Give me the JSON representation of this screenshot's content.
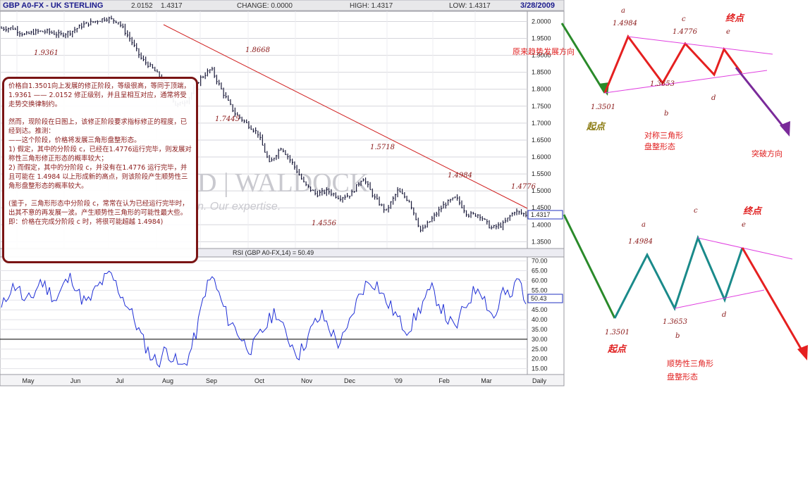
{
  "header": {
    "title": "GBP A0-FX - UK STERLING",
    "max_price": "2.0152",
    "last": "1.4317",
    "change": "CHANGE: 0.0000",
    "high": "HIGH: 1.4317",
    "low": "LOW: 1.4317",
    "date": "3/28/2009"
  },
  "watermark": {
    "text": "D | WALDOCK",
    "tagline": "n. Our expertise."
  },
  "rsi_label": "RSI (GBP A0-FX,14) = 50.49",
  "colors": {
    "price": "#1a1a3a",
    "rsi": "#1f2fd6",
    "trendline": "#d02020",
    "annotation": "#8b1a1a",
    "up_leg": "#2a8a2a",
    "triangle": "#e040e0"
  },
  "chart_data": [
    {
      "type": "bar",
      "title": "GBP A0-FX - UK STERLING",
      "x": [
        "Apr-25",
        "May-05",
        "May-15",
        "May-25",
        "Jun-05",
        "Jun-15",
        "Jun-25",
        "Jul-05",
        "Jul-15",
        "Jul-25",
        "Aug-01",
        "Aug-08",
        "Aug-15",
        "Aug-22",
        "Aug-29",
        "Sep-05",
        "Sep-10",
        "Sep-15",
        "Sep-22",
        "Sep-29",
        "Oct-06",
        "Oct-13",
        "Oct-20",
        "Oct-24",
        "Oct-31",
        "Nov-07",
        "Nov-14",
        "Nov-21",
        "Nov-28",
        "Dec-05",
        "Dec-12",
        "Dec-19",
        "Dec-29",
        "Jan-05",
        "Jan-12",
        "Jan-19",
        "Jan-23",
        "Jan-30",
        "Feb-06",
        "Feb-13",
        "Feb-20",
        "Feb-27",
        "Mar-06",
        "Mar-13",
        "Mar-20",
        "Mar-27"
      ],
      "values": [
        1.98,
        1.98,
        1.96,
        1.97,
        1.97,
        1.96,
        1.97,
        1.99,
        2.0,
        2.01,
        2.0,
        1.95,
        1.89,
        1.86,
        1.82,
        1.75,
        1.77,
        1.83,
        1.86,
        1.79,
        1.73,
        1.7,
        1.67,
        1.58,
        1.63,
        1.58,
        1.52,
        1.49,
        1.5,
        1.48,
        1.49,
        1.54,
        1.48,
        1.44,
        1.5,
        1.47,
        1.38,
        1.42,
        1.46,
        1.48,
        1.43,
        1.43,
        1.39,
        1.4,
        1.44,
        1.43
      ],
      "ylim": [
        1.33,
        2.03
      ],
      "yticks": [
        "2.0000",
        "1.9500",
        "1.9000",
        "1.8500",
        "1.8000",
        "1.7500",
        "1.7000",
        "1.6500",
        "1.6000",
        "1.5500",
        "1.5000",
        "1.4500",
        "1.4000",
        "1.3500"
      ],
      "xticks": [
        "May",
        "Jun",
        "Jul",
        "Aug",
        "Sep",
        "Oct",
        "Nov",
        "Dec",
        "'09",
        "Feb",
        "Mar",
        "Daily"
      ],
      "last_value": "1.4317",
      "annotations": [
        "2.0152",
        "1.9361",
        "1.8668",
        "1.7445",
        "1.5718",
        "1.4984",
        "1.4776",
        "1.4556",
        "1.3501",
        "1.3653"
      ]
    },
    {
      "type": "line",
      "title": "RSI (GBP A0-FX,14) = 50.49",
      "values": [
        45,
        55,
        58,
        48,
        52,
        60,
        55,
        50,
        58,
        62,
        52,
        48,
        55,
        60,
        63,
        55,
        48,
        40,
        30,
        22,
        18,
        25,
        20,
        15,
        22,
        35,
        55,
        62,
        50,
        40,
        35,
        28,
        25,
        32,
        38,
        45,
        35,
        28,
        22,
        30,
        38,
        42,
        35,
        28,
        32,
        45,
        55,
        60,
        58,
        50,
        45,
        38,
        35,
        42,
        50,
        55,
        48,
        40,
        35,
        45,
        52,
        58,
        48,
        40,
        55,
        50,
        62,
        50
      ],
      "ylim": [
        12,
        72
      ],
      "yticks": [
        "70.00",
        "65.00",
        "60.00",
        "55.00",
        "50.00",
        "45.00",
        "40.00",
        "35.00",
        "30.00",
        "25.00",
        "20.00",
        "15.00"
      ],
      "reference_line": 30,
      "last_value": "50.43"
    }
  ],
  "note": {
    "p1": "价格自1.3501向上发展的修正阶段，等级很高，等同于顶端，1.9361 —— 2.0152 修正级别，并且呈相互对应，通常将受走势交换律制约。",
    "p2": "然而，现阶段在日图上，该修正阶段要求指标修正的程度，已经到达。推测：",
    "p3": "——这个阶段，价格将发展三角形盘整形态。",
    "p4": "1) 假定，其中的分阶段 c，已经在1.4776运行完毕，则发展对称性三角形修正形态的概率较大；",
    "p5": "2) 而假定，其中的分阶段 c，并没有在1.4776 运行完毕，并且可能在 1.4984 以上形成新的高点，则该阶段产生顺势性三角形盘整形态的概率较大。",
    "p6": "(鉴于，三角形形态中分阶段 c，常常在认为已经运行完毕时，出其不意的再发展一波。产生顺势性三角形的可能性最大些。即：价格在完成分阶段 c 时，将很可能超越 1.4984)"
  },
  "diagram_top": {
    "labels": {
      "a": "a",
      "b": "b",
      "c": "c",
      "d": "d",
      "e": "e"
    },
    "values": {
      "start": "1.3501",
      "a": "1.4984",
      "b": "1.3653",
      "c": "1.4776"
    },
    "start_label": "起点",
    "end_label": "终点",
    "trend_label": "原来趋势发展方向",
    "pattern_label": [
      "对称三角形",
      "盘整形态"
    ],
    "breakout_label": "突破方向"
  },
  "diagram_bottom": {
    "labels": {
      "a": "a",
      "b": "b",
      "c": "c",
      "d": "d",
      "e": "e"
    },
    "values": {
      "start": "1.3501",
      "a": "1.4984",
      "b": "1.3653"
    },
    "start_label": "起点",
    "end_label": "终点",
    "pattern_label": [
      "顺势性三角形",
      "盘整形态"
    ]
  }
}
